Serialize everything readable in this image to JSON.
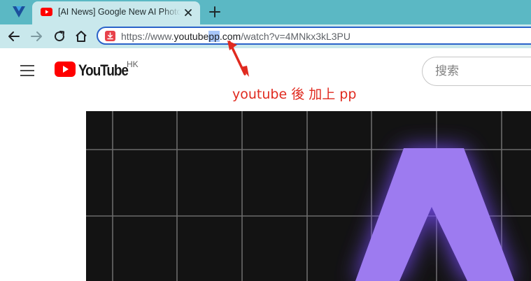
{
  "browser": {
    "tab": {
      "title": "[AI News] Google New AI Photo",
      "favicon": "youtube-favicon-icon",
      "close_icon": "close-icon"
    },
    "new_tab_icon": "plus-icon",
    "toolbar": {
      "back_icon": "arrow-left-icon",
      "forward_icon": "arrow-right-icon",
      "reload_icon": "reload-icon",
      "home_icon": "home-icon"
    },
    "omnibox": {
      "url_prefix": "https://www.",
      "url_domain_before": "youtube",
      "url_highlight": "pp",
      "url_domain_after": ".com",
      "url_path": "/watch?v=4MNkx3kL3PU"
    }
  },
  "youtube": {
    "logo_text": "YouTube",
    "region": "HK",
    "search_placeholder": "搜索"
  },
  "annotation": {
    "text": "youtube 後 加上 pp",
    "color": "#e02a1f"
  },
  "colors": {
    "tabstrip": "#5bb8c4",
    "toolbar": "#c9e8ec",
    "youtube_red": "#ff0000",
    "video_bg": "#131313",
    "video_glyph": "#9d7bf0"
  }
}
